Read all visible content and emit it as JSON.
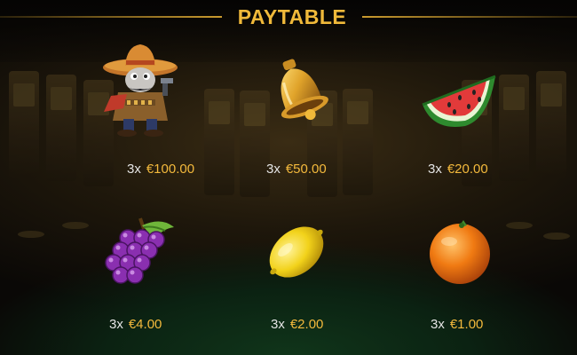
{
  "title": "PAYTABLE",
  "symbols": [
    {
      "icon": "bandit-icon",
      "multiplier": "3x",
      "amount": "€100.00"
    },
    {
      "icon": "bell-icon",
      "multiplier": "3x",
      "amount": "€50.00"
    },
    {
      "icon": "watermelon-icon",
      "multiplier": "3x",
      "amount": "€20.00"
    },
    {
      "icon": "grapes-icon",
      "multiplier": "3x",
      "amount": "€4.00"
    },
    {
      "icon": "lemon-icon",
      "multiplier": "3x",
      "amount": "€2.00"
    },
    {
      "icon": "orange-icon",
      "multiplier": "3x",
      "amount": "€1.00"
    }
  ],
  "colors": {
    "gold": "#f3b93c",
    "felt": "#10351a"
  }
}
